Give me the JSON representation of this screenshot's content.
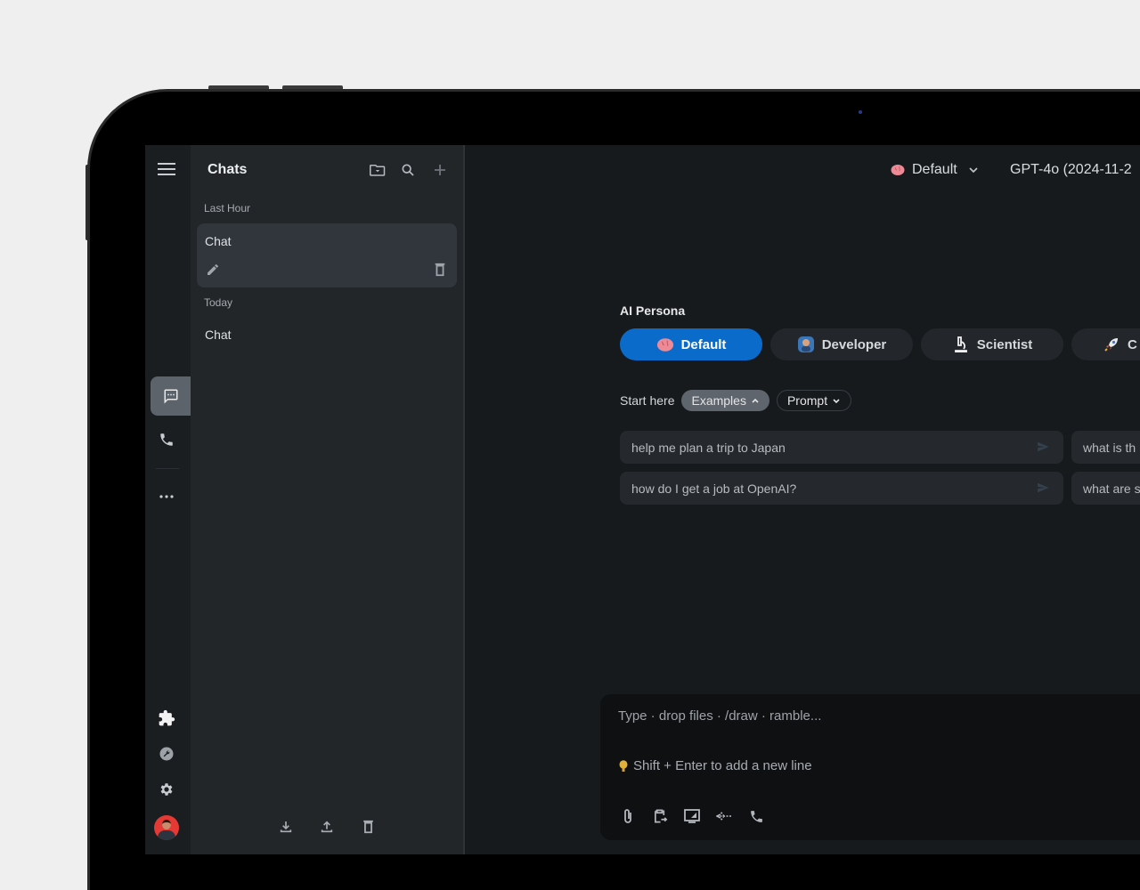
{
  "rail": {
    "items": [
      {
        "name": "chat",
        "active": true
      },
      {
        "name": "call",
        "active": false
      },
      {
        "name": "more",
        "active": false
      }
    ],
    "bottom_items": [
      "plugins",
      "tools",
      "settings",
      "profile"
    ]
  },
  "sidebar": {
    "title": "Chats",
    "groups": [
      {
        "label": "Last Hour",
        "chats": [
          {
            "title": "Chat",
            "active": true
          }
        ]
      },
      {
        "label": "Today",
        "chats": [
          {
            "title": "Chat",
            "active": false
          }
        ]
      }
    ]
  },
  "header": {
    "persona": "Default",
    "model": "GPT-4o (2024-11-2"
  },
  "persona_section": {
    "label": "AI Persona",
    "personas": [
      {
        "label": "Default",
        "icon": "brain",
        "active": true
      },
      {
        "label": "Developer",
        "icon": "developer",
        "active": false
      },
      {
        "label": "Scientist",
        "icon": "microscope",
        "active": false
      },
      {
        "label": "C",
        "icon": "rocket",
        "active": false
      }
    ]
  },
  "start": {
    "label": "Start here",
    "examples_label": "Examples",
    "prompt_label": "Prompt"
  },
  "examples": [
    "help me plan a trip to Japan",
    "what is th",
    "how do I get a job at OpenAI?",
    "what are s"
  ],
  "composer": {
    "placeholder": "Type · drop files · /draw · ramble...",
    "hint": "Shift + Enter to add a new line"
  },
  "colors": {
    "accent": "#0b6bcb",
    "sidebar_bg": "#222629",
    "main_bg": "#171a1d",
    "rail_bg": "#1b1e21"
  }
}
